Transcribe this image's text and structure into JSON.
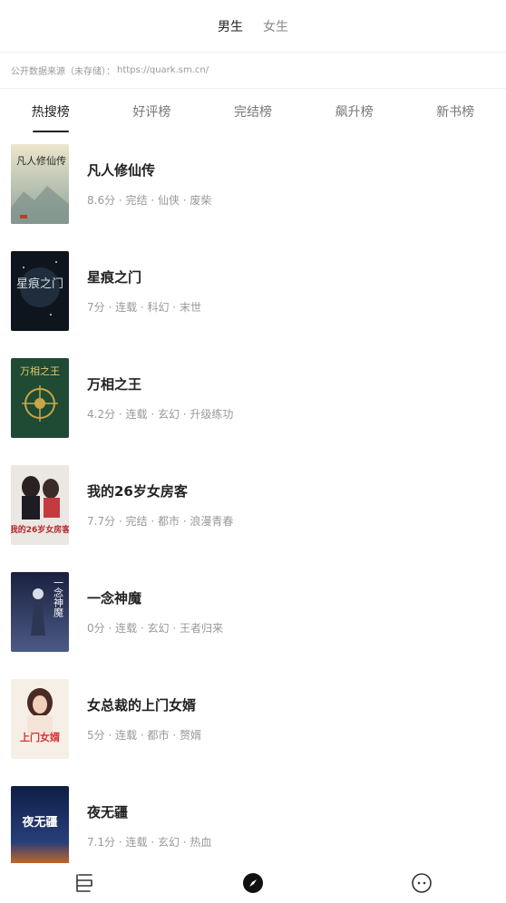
{
  "gender_tabs": [
    {
      "label": "男生",
      "active": true
    },
    {
      "label": "女生",
      "active": false
    }
  ],
  "source": {
    "label": "公开数据来源（未存储）：",
    "url": "https://quark.sm.cn/"
  },
  "rank_tabs": [
    {
      "label": "热搜榜",
      "active": true
    },
    {
      "label": "好评榜",
      "active": false
    },
    {
      "label": "完结榜",
      "active": false
    },
    {
      "label": "飙升榜",
      "active": false
    },
    {
      "label": "新书榜",
      "active": false
    }
  ],
  "books": [
    {
      "title": "凡人修仙传",
      "meta": "8.6分 · 完结 · 仙侠 · 废柴",
      "cover_text": "凡人修仙传",
      "cover_colors": [
        "#d9d3b8",
        "#8fa39a"
      ]
    },
    {
      "title": "星痕之门",
      "meta": "7分 · 连载 · 科幻 · 末世",
      "cover_text": "星痕之门",
      "cover_colors": [
        "#10161f",
        "#2a3a4a"
      ]
    },
    {
      "title": "万相之王",
      "meta": "4.2分 · 连载 · 玄幻 · 升级练功",
      "cover_text": "万相之王",
      "cover_colors": [
        "#1f4a33",
        "#2f6a46"
      ]
    },
    {
      "title": "我的26岁女房客",
      "meta": "7.7分 · 完结 · 都市 · 浪漫青春",
      "cover_text": "我的26岁女房客",
      "cover_colors": [
        "#e8e4e0",
        "#b3262b"
      ]
    },
    {
      "title": "一念神魔",
      "meta": "0分 · 连载 · 玄幻 · 王者归来",
      "cover_text": "一念神魔",
      "cover_colors": [
        "#1c2440",
        "#4b5a86"
      ]
    },
    {
      "title": "女总裁的上门女婿",
      "meta": "5分 · 连载 · 都市 · 赘婿",
      "cover_text": "上门女婿",
      "cover_colors": [
        "#f4ece4",
        "#d8302e"
      ]
    },
    {
      "title": "夜无疆",
      "meta": "7.1分 · 连载 · 玄幻 · 热血",
      "cover_text": "夜无疆",
      "cover_colors": [
        "#0f1e45",
        "#d46a1e"
      ]
    }
  ],
  "bottom_nav": [
    {
      "icon": "bookshelf-icon"
    },
    {
      "icon": "compass-icon"
    },
    {
      "icon": "profile-face-icon"
    }
  ]
}
